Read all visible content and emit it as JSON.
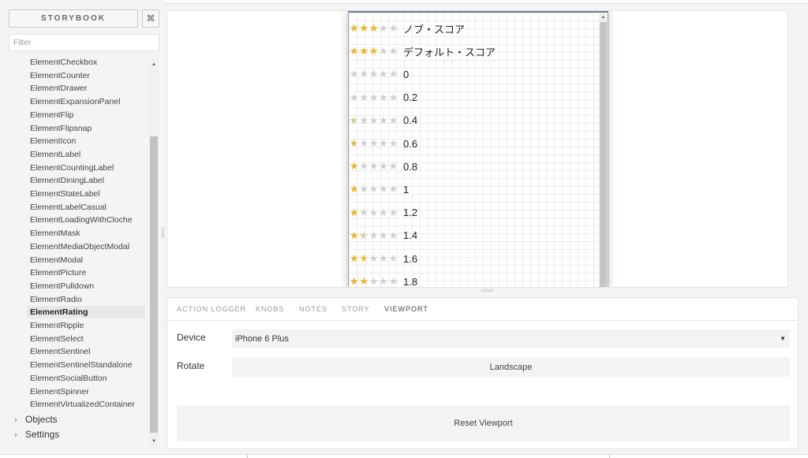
{
  "sidebar": {
    "brand": "STORYBOOK",
    "shortcut_icon": "cmd-icon",
    "shortcut_glyph": "⌘",
    "filter_placeholder": "Filter",
    "stories": [
      "ElementCheckbox",
      "ElementCounter",
      "ElementDrawer",
      "ElementExpansionPanel",
      "ElementFlip",
      "ElementFlipsnap",
      "ElementIcon",
      "ElementLabel",
      "ElementCountingLabel",
      "ElementDiningLabel",
      "ElementStateLabel",
      "ElementLabelCasual",
      "ElementLoadingWithCloche",
      "ElementMask",
      "ElementMediaObjectModal",
      "ElementModal",
      "ElementPicture",
      "ElementPulldown",
      "ElementRadio",
      "ElementRating",
      "ElementRipple",
      "ElementSelect",
      "ElementSentinel",
      "ElementSentinelStandalone",
      "ElementSocialButton",
      "ElementSpinner",
      "ElementVirtualizedContainer"
    ],
    "active_story": "ElementRating",
    "kinds": [
      "Objects",
      "Settings"
    ]
  },
  "preview": {
    "rows": [
      {
        "label": "ノブ・スコア",
        "rating": 3
      },
      {
        "label": "デフォルト・スコア",
        "rating": 3
      },
      {
        "label": "0",
        "rating": 0
      },
      {
        "label": "0.2",
        "rating": 0.2
      },
      {
        "label": "0.4",
        "rating": 0.4
      },
      {
        "label": "0.6",
        "rating": 0.6
      },
      {
        "label": "0.8",
        "rating": 0.8
      },
      {
        "label": "1",
        "rating": 1
      },
      {
        "label": "1.2",
        "rating": 1.2
      },
      {
        "label": "1.4",
        "rating": 1.4
      },
      {
        "label": "1.6",
        "rating": 1.6
      },
      {
        "label": "1.8",
        "rating": 1.8
      }
    ],
    "max_stars": 5,
    "star_color": "#f2b51b",
    "empty_star_color": "#cfcfcf"
  },
  "addons": {
    "tabs": [
      "ACTION LOGGER",
      "KNOBS",
      "NOTES",
      "STORY",
      "VIEWPORT"
    ],
    "active_tab": "VIEWPORT",
    "device_label": "Device",
    "device_value": "iPhone 6 Plus",
    "rotate_label": "Rotate",
    "rotate_button": "Landscape",
    "reset_button": "Reset Viewport"
  }
}
